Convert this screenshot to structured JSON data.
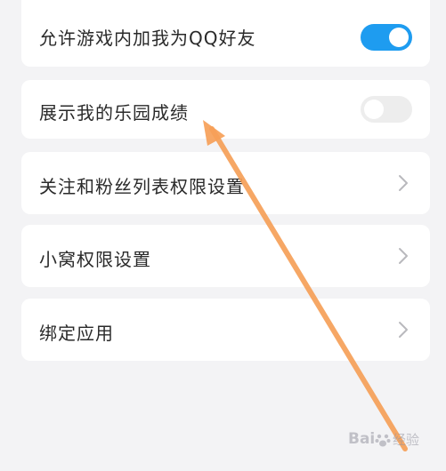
{
  "settings": {
    "items": [
      {
        "label": "允许游戏内加我为QQ好友",
        "type": "toggle",
        "enabled": true
      },
      {
        "label": "展示我的乐园成绩",
        "type": "toggle",
        "enabled": false
      },
      {
        "label": "关注和粉丝列表权限设置",
        "type": "link",
        "icon": "chevron-right-icon"
      },
      {
        "label": "小窝权限设置",
        "type": "link",
        "icon": "chevron-right-icon"
      },
      {
        "label": "绑定应用",
        "type": "link",
        "icon": "chevron-right-icon"
      }
    ]
  },
  "watermark": {
    "brand_text": "Bai",
    "suffix_text": "经验"
  },
  "colors": {
    "page_background": "#f3f3f5",
    "card_background": "#ffffff",
    "toggle_on": "#1e9cf0",
    "toggle_off": "#ededed",
    "annotation_arrow": "#f6a058",
    "text_primary": "#2a2a2a",
    "chevron": "#b9b9bd"
  }
}
